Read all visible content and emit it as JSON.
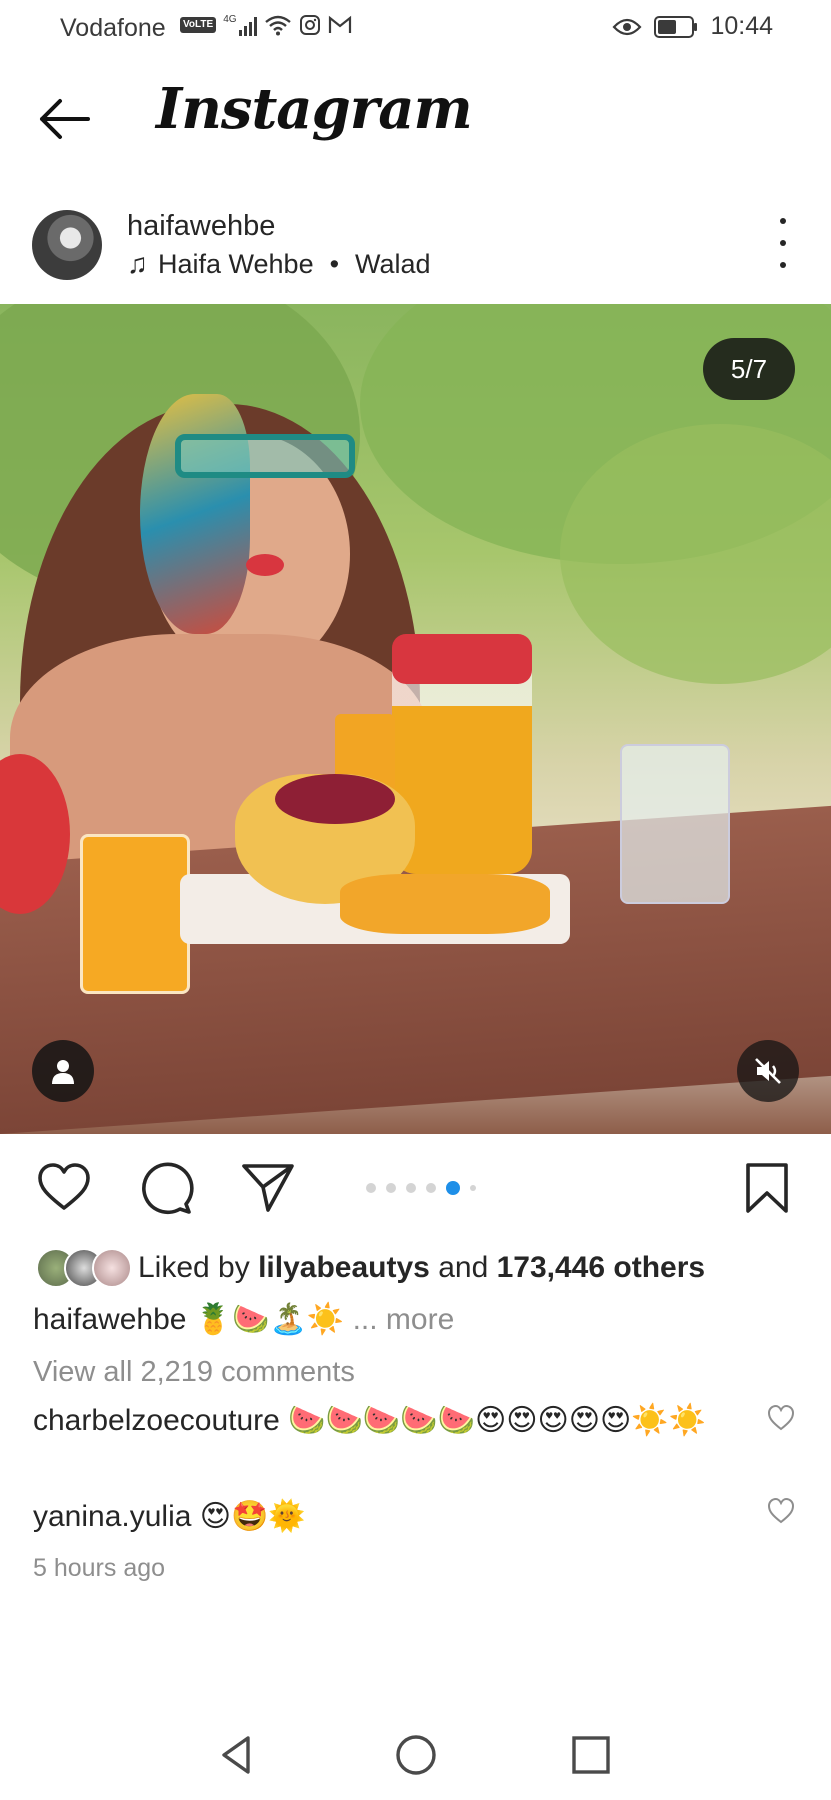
{
  "status_bar": {
    "carrier": "Vodafone",
    "volte": "VoLTE",
    "network": "4G",
    "time": "10:44"
  },
  "header": {
    "app_title": "Instagram"
  },
  "post": {
    "username": "haifawehbe",
    "music_artist": "Haifa Wehbe",
    "music_separator": "•",
    "music_title": "Walad",
    "carousel_counter": "5/7",
    "carousel_total": 7,
    "carousel_active_index": 5
  },
  "likes": {
    "prefix": "Liked by",
    "liker": "lilyabeautys",
    "connector": "and",
    "others": "173,446 others"
  },
  "caption": {
    "username": "haifawehbe",
    "text": "🍍🍉🏝️☀️",
    "more": "... more"
  },
  "view_comments": "View all 2,219 comments",
  "comments": [
    {
      "user": "charbelzoecouture",
      "text": "🍉🍉🍉🍉🍉😍😍😍😍😍☀️☀️"
    },
    {
      "user": "yanina.yulia",
      "text": "😍🤩🌞"
    }
  ],
  "time_ago": "5 hours ago",
  "colors": {
    "accent_blue": "#1e8fe8",
    "text_primary": "#262626",
    "text_secondary": "#8e8e8e"
  }
}
